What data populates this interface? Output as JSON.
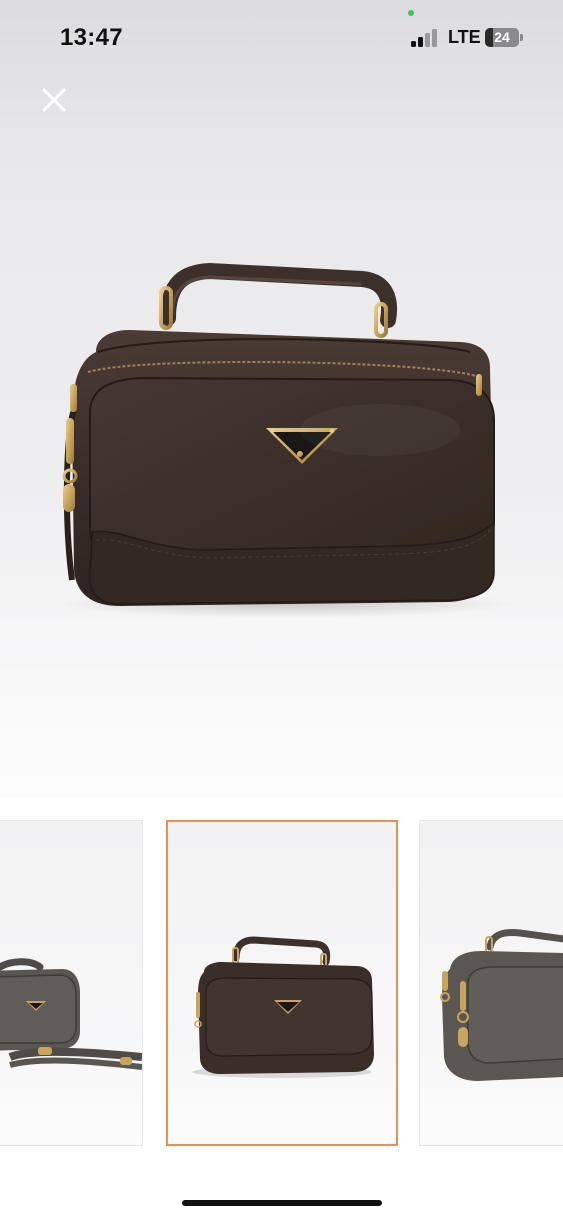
{
  "status_bar": {
    "time": "13:47",
    "network": "LTE",
    "battery": "24",
    "battery_level_percent": 24
  },
  "gallery": {
    "close_icon": "close-icon",
    "selected_thumbnail_index": 1,
    "thumbnail_count": 3,
    "accent_color": "#e8914f"
  },
  "product": {
    "bag_color": "#3a2d28",
    "hardware_color": "#c9a45c"
  }
}
